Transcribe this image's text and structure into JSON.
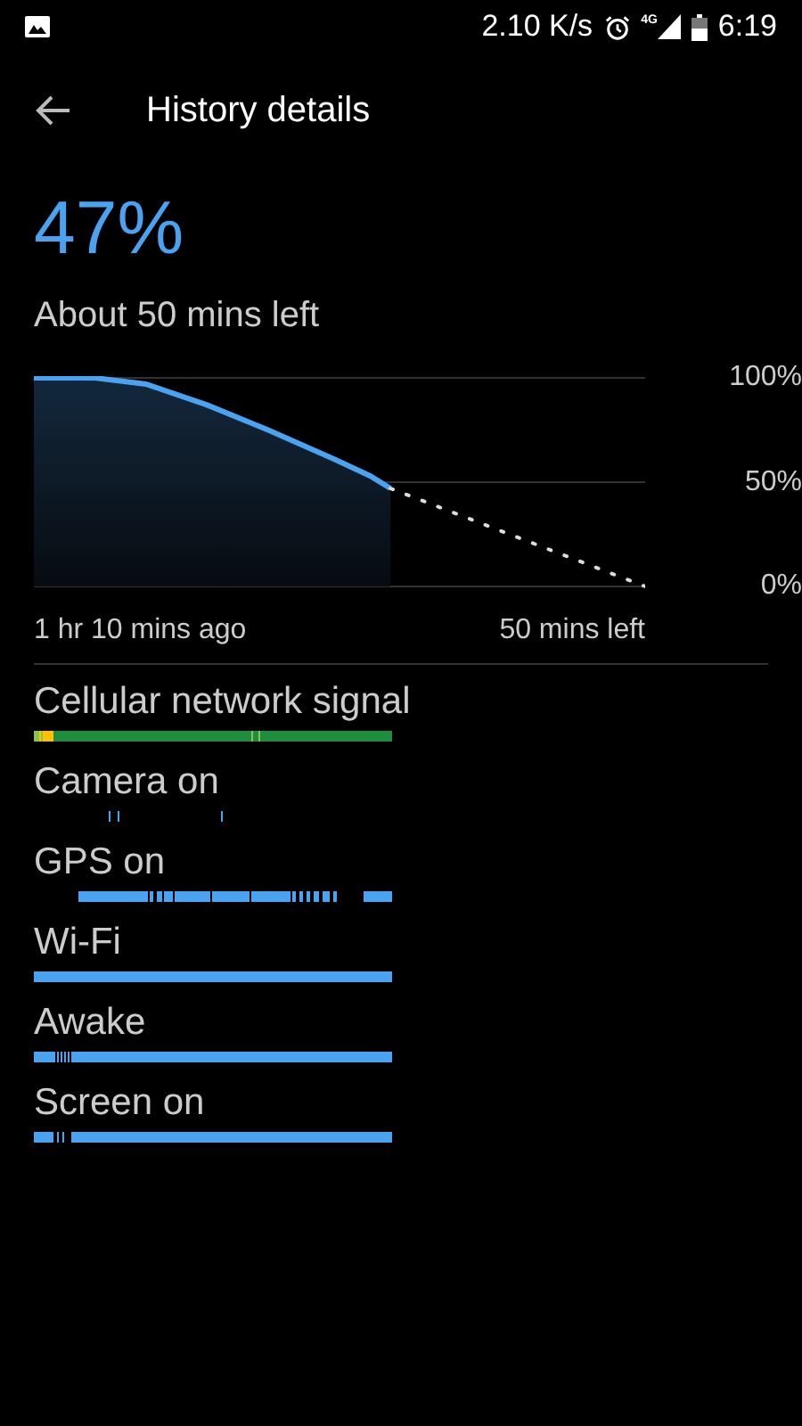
{
  "status_bar": {
    "speed": "2.10 K/s",
    "network": "4G",
    "time": "6:19"
  },
  "header": {
    "title": "History details"
  },
  "battery": {
    "percent": "47%",
    "remaining": "About 50 mins left"
  },
  "chart": {
    "axis_labels": [
      "100%",
      "50%",
      "0%"
    ]
  },
  "time_range": {
    "start": "1 hr 10 mins ago",
    "end": "50 mins left"
  },
  "timelines": [
    {
      "label": "Cellular network signal",
      "kind": "signal"
    },
    {
      "label": "Camera on",
      "kind": "sparse"
    },
    {
      "label": "GPS on",
      "kind": "gps"
    },
    {
      "label": "Wi-Fi",
      "kind": "full"
    },
    {
      "label": "Awake",
      "kind": "awake"
    },
    {
      "label": "Screen on",
      "kind": "screen"
    }
  ]
}
